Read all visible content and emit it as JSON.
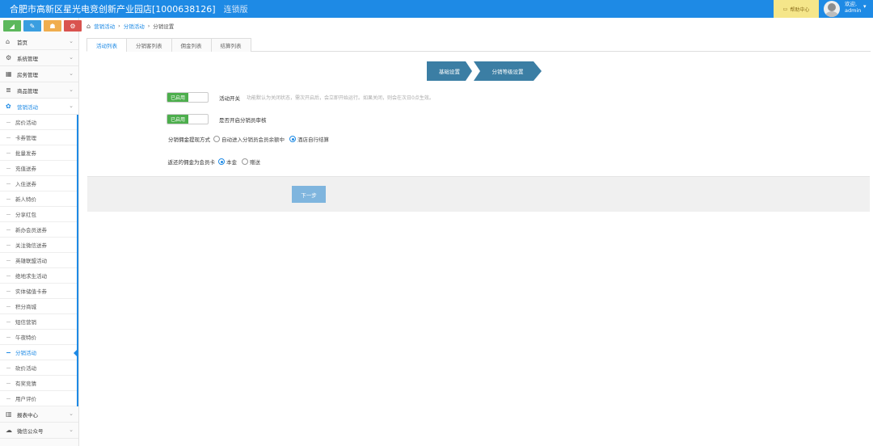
{
  "header": {
    "title": "合肥市高新区星光电竞创新产业园店[1000638126]",
    "edition": "连锁版",
    "help_label": "帮助中心",
    "welcome": "欢迎,",
    "username": "admin"
  },
  "quick_buttons": [
    {
      "icon": "chart-icon",
      "color": "#5cb85c",
      "glyph": "◢"
    },
    {
      "icon": "edit-icon",
      "color": "#3a9ee0",
      "glyph": "✎"
    },
    {
      "icon": "users-icon",
      "color": "#f0ad4e",
      "glyph": "☗"
    },
    {
      "icon": "settings-icon",
      "color": "#d9534f",
      "glyph": "⚙"
    }
  ],
  "sidebar": {
    "top_items": [
      {
        "label": "首页",
        "icon": "home-icon",
        "glyph": "⌂"
      },
      {
        "label": "系统管理",
        "icon": "gear-icon",
        "glyph": "⚙"
      },
      {
        "label": "房务管理",
        "icon": "building-icon",
        "glyph": "▦"
      },
      {
        "label": "商品管理",
        "icon": "database-icon",
        "glyph": "≣"
      },
      {
        "label": "营销活动",
        "icon": "gift-icon",
        "glyph": "✿"
      }
    ],
    "sub_items": [
      "房价活动",
      "卡券管理",
      "批量发券",
      "充值送券",
      "入住送券",
      "新人特价",
      "分享红包",
      "新办会员送券",
      "关注微信送券",
      "英雄联盟活动",
      "绝地求生活动",
      "实体储值卡券",
      "积分商城",
      "短信营销",
      "午夜特价",
      "分销活动",
      "砍价活动",
      "有奖竞猜",
      "用户评价"
    ],
    "active_sub": 15,
    "bottom_items": [
      {
        "label": "报表中心",
        "icon": "bar-chart-icon",
        "glyph": "▥"
      },
      {
        "label": "微信公众号",
        "icon": "cloud-icon",
        "glyph": "☁"
      }
    ]
  },
  "breadcrumb": {
    "items": [
      "营销活动",
      "分销活动",
      "分销设置"
    ],
    "sep": "›"
  },
  "tabs": [
    "活动列表",
    "分销客列表",
    "佣金列表",
    "结算列表"
  ],
  "steps": [
    "基础设置",
    "分销等级设置"
  ],
  "form": {
    "switch_label": "活动开关",
    "switch_state": "已启用",
    "switch_hint": "功能默认为关闭状态，需次开启后，会立即开始运行。如果关闭，则会在次日0点生效。",
    "audit_state": "已启用",
    "audit_label": "是否开启分销员审核",
    "withdraw_label": "分销佣金提现方式",
    "withdraw_options": [
      "自动进入分销员会员余额中",
      "酒店自行结算"
    ],
    "withdraw_selected": 1,
    "return_label": "返还的佣金为会员卡",
    "return_options": [
      "本金",
      "赠送"
    ],
    "return_selected": 0
  },
  "next_label": "下一步",
  "colors": {
    "brand": "#1e8ae5",
    "step": "#3b7ea4",
    "toggle_on": "#4cae4c"
  }
}
